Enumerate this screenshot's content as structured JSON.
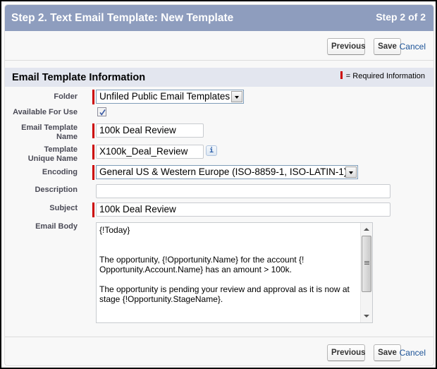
{
  "header": {
    "title": "Step 2. Text Email Template: New Template",
    "step": "Step 2 of 2"
  },
  "buttons": {
    "previous": "Previous",
    "save": "Save",
    "cancel": "Cancel"
  },
  "section": {
    "title": "Email Template Information",
    "required_legend": "= Required Information"
  },
  "form": {
    "folder": {
      "label": "Folder",
      "value": "Unfiled Public Email Templates",
      "required": true
    },
    "available_for_use": {
      "label": "Available For Use",
      "checked": true
    },
    "template_name": {
      "label_line1": "Email Template",
      "label_line2": "Name",
      "value": "100k Deal Review",
      "required": true
    },
    "unique_name": {
      "label_line1": "Template",
      "label_line2": "Unique Name",
      "value": "X100k_Deal_Review",
      "required": true,
      "info_icon": "i"
    },
    "encoding": {
      "label": "Encoding",
      "value": "General US & Western Europe (ISO-8859-1, ISO-LATIN-1)",
      "required": true
    },
    "description": {
      "label": "Description",
      "value": ""
    },
    "subject": {
      "label": "Subject",
      "value": "100k Deal Review",
      "required": true
    },
    "email_body": {
      "label": "Email Body",
      "lines": [
        "{!Today}",
        "The opportunity, {!Opportunity.Name} for the account {!",
        "Opportunity.Account.Name} has an amount > 100k.",
        "The opportunity is pending your review and approval as it is now at",
        "stage {!Opportunity.StageName}."
      ]
    }
  },
  "colors": {
    "header_bg": "#8e9dbe",
    "section_bg": "#e3e6ef",
    "required": "#cc0000",
    "link": "#1b5297"
  }
}
